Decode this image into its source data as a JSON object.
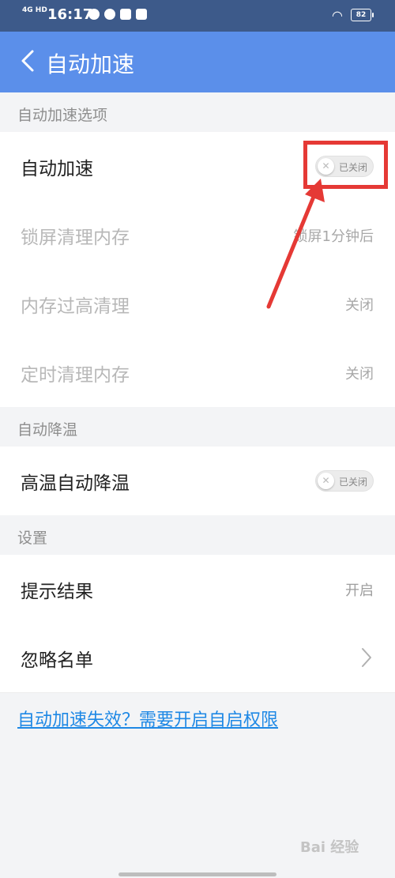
{
  "status_bar": {
    "network": "4G HD",
    "time": "16:17",
    "battery": "82"
  },
  "header": {
    "title": "自动加速"
  },
  "sections": {
    "auto_accel": {
      "title": "自动加速选项"
    },
    "auto_cool": {
      "title": "自动降温"
    },
    "settings": {
      "title": "设置"
    }
  },
  "rows": {
    "auto_accel": {
      "label": "自动加速",
      "toggle_text": "已关闭",
      "state": "off"
    },
    "lock_clean": {
      "label": "锁屏清理内存",
      "value": "锁屏1分钟后"
    },
    "high_mem_clean": {
      "label": "内存过高清理",
      "value": "关闭"
    },
    "timed_clean": {
      "label": "定时清理内存",
      "value": "关闭"
    },
    "high_temp_cool": {
      "label": "高温自动降温",
      "toggle_text": "已关闭",
      "state": "off"
    },
    "hint_result": {
      "label": "提示结果",
      "value": "开启"
    },
    "ignore_list": {
      "label": "忽略名单"
    }
  },
  "link": {
    "text": "自动加速失效？需要开启自启权限"
  },
  "watermark": {
    "text": "Bai 经验"
  },
  "colors": {
    "header": "#5b8fea",
    "status_bar": "#3d5a8a",
    "annotation": "#e53935",
    "link": "#1e88e5"
  }
}
